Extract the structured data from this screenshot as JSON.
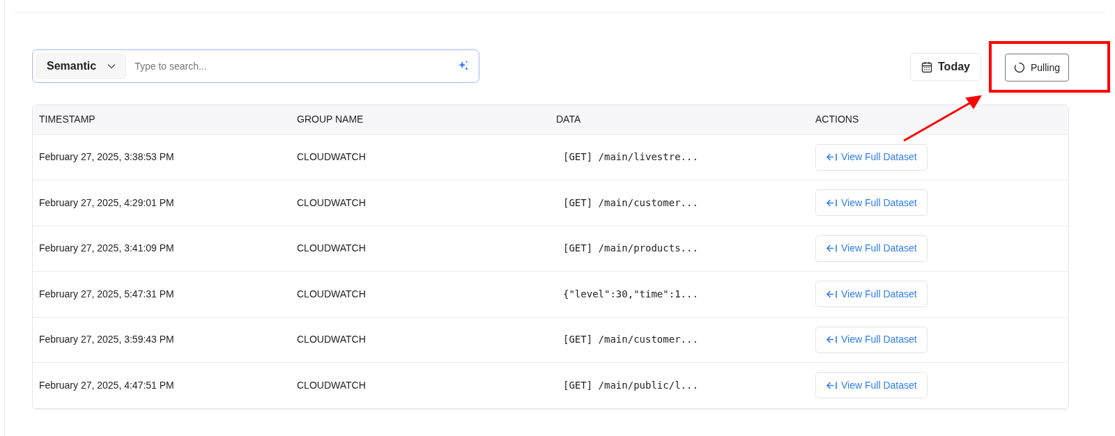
{
  "search": {
    "mode": "Semantic",
    "placeholder": "Type to search..."
  },
  "date_button": {
    "label": "Today"
  },
  "pull_button": {
    "label": "Pulling",
    "loading": true
  },
  "table": {
    "columns": [
      "TIMESTAMP",
      "GROUP NAME",
      "DATA",
      "ACTIONS"
    ],
    "rows": [
      {
        "timestamp": "February 27, 2025, 3:38:53 PM",
        "group": "CLOUDWATCH",
        "data": "[GET] /main/livestre...",
        "action": "View Full Dataset"
      },
      {
        "timestamp": "February 27, 2025, 4:29:01 PM",
        "group": "CLOUDWATCH",
        "data": "[GET] /main/customer...",
        "action": "View Full Dataset"
      },
      {
        "timestamp": "February 27, 2025, 3:41:09 PM",
        "group": "CLOUDWATCH",
        "data": "[GET] /main/products...",
        "action": "View Full Dataset"
      },
      {
        "timestamp": "February 27, 2025, 5:47:31 PM",
        "group": "CLOUDWATCH",
        "data": "{\"level\":30,\"time\":1...",
        "action": "View Full Dataset"
      },
      {
        "timestamp": "February 27, 2025, 3:59:43 PM",
        "group": "CLOUDWATCH",
        "data": "[GET] /main/customer...",
        "action": "View Full Dataset"
      },
      {
        "timestamp": "February 27, 2025, 4:47:51 PM",
        "group": "CLOUDWATCH",
        "data": "[GET] /main/public/l...",
        "action": "View Full Dataset"
      }
    ]
  }
}
